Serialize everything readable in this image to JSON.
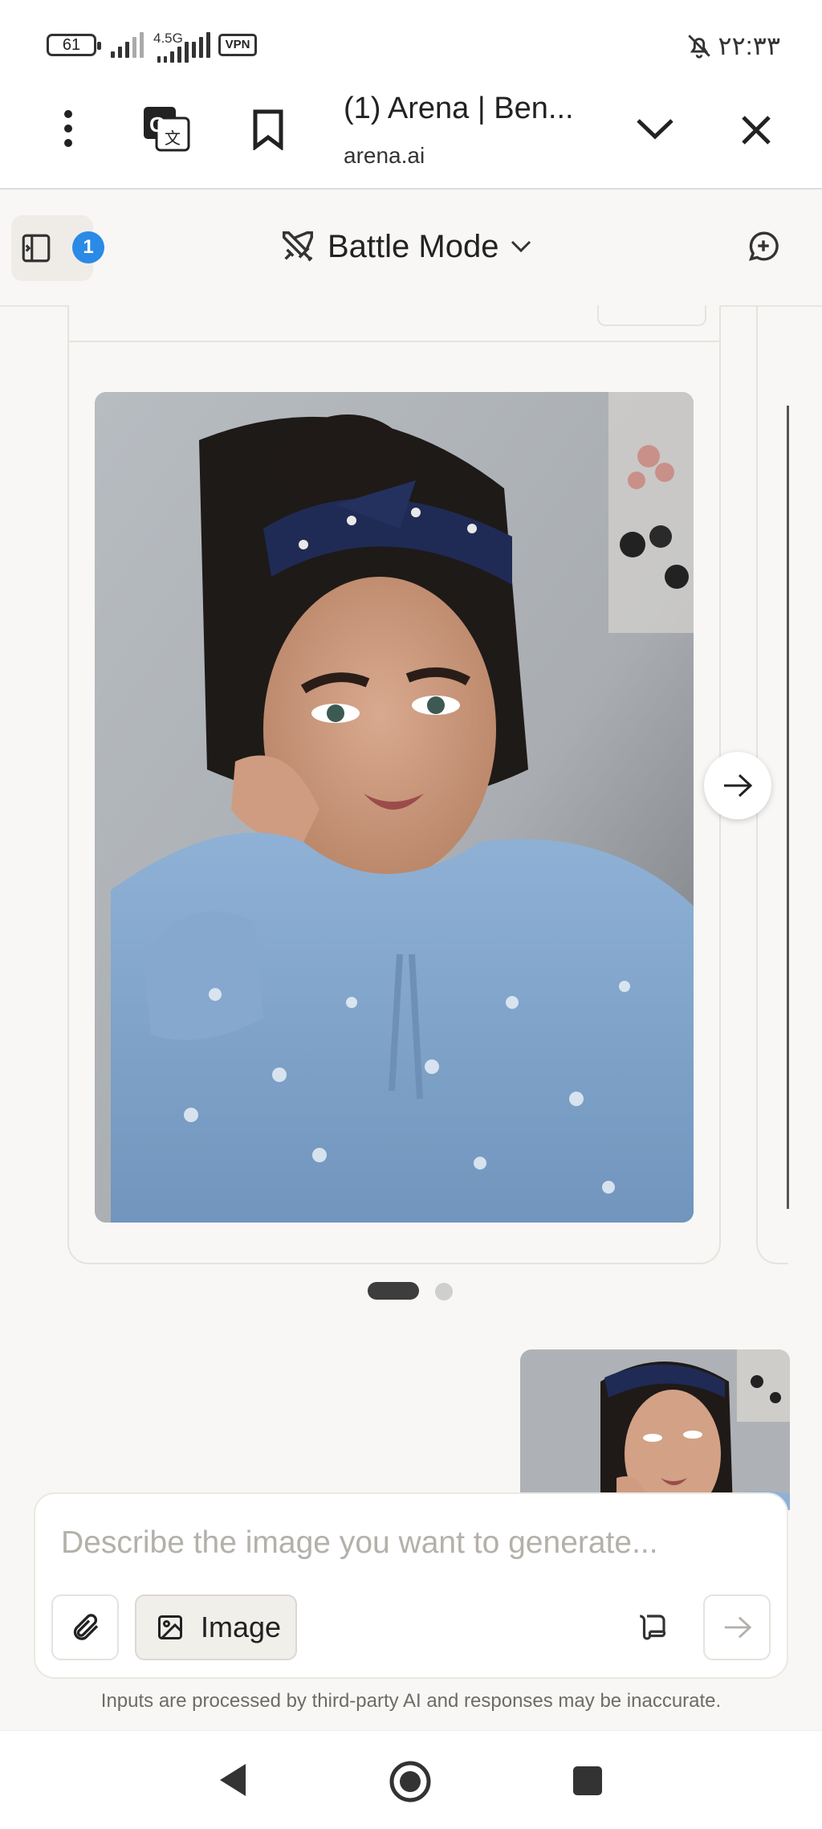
{
  "status_bar": {
    "battery": "61",
    "network": "4.5G",
    "vpn": "VPN",
    "time": "۲۲:۳۳"
  },
  "browser": {
    "tab_title": "(1) Arena | Ben...",
    "url": "arena.ai"
  },
  "app_header": {
    "notification_count": "1",
    "mode": "Battle Mode"
  },
  "gallery": {
    "pages": 2,
    "current_page": 1
  },
  "composer": {
    "placeholder": "Describe the image you want to generate...",
    "value": "",
    "image_toggle_label": "Image"
  },
  "footer": {
    "disclaimer": "Inputs are processed by third-party AI and responses may be inaccurate."
  },
  "icons": {
    "menu": "more-vertical-icon",
    "translate": "google-translate-icon",
    "bookmark": "bookmark-icon",
    "expand": "chevron-down-icon",
    "close": "close-icon",
    "sidebar": "sidebar-toggle-icon",
    "battle": "swords-icon",
    "new_chat": "new-chat-icon",
    "next": "arrow-right-icon",
    "attach": "paperclip-icon",
    "image": "image-icon",
    "send": "send-arrow-icon"
  },
  "colors": {
    "accent_badge": "#2a8ae6",
    "background": "#f8f7f5"
  }
}
